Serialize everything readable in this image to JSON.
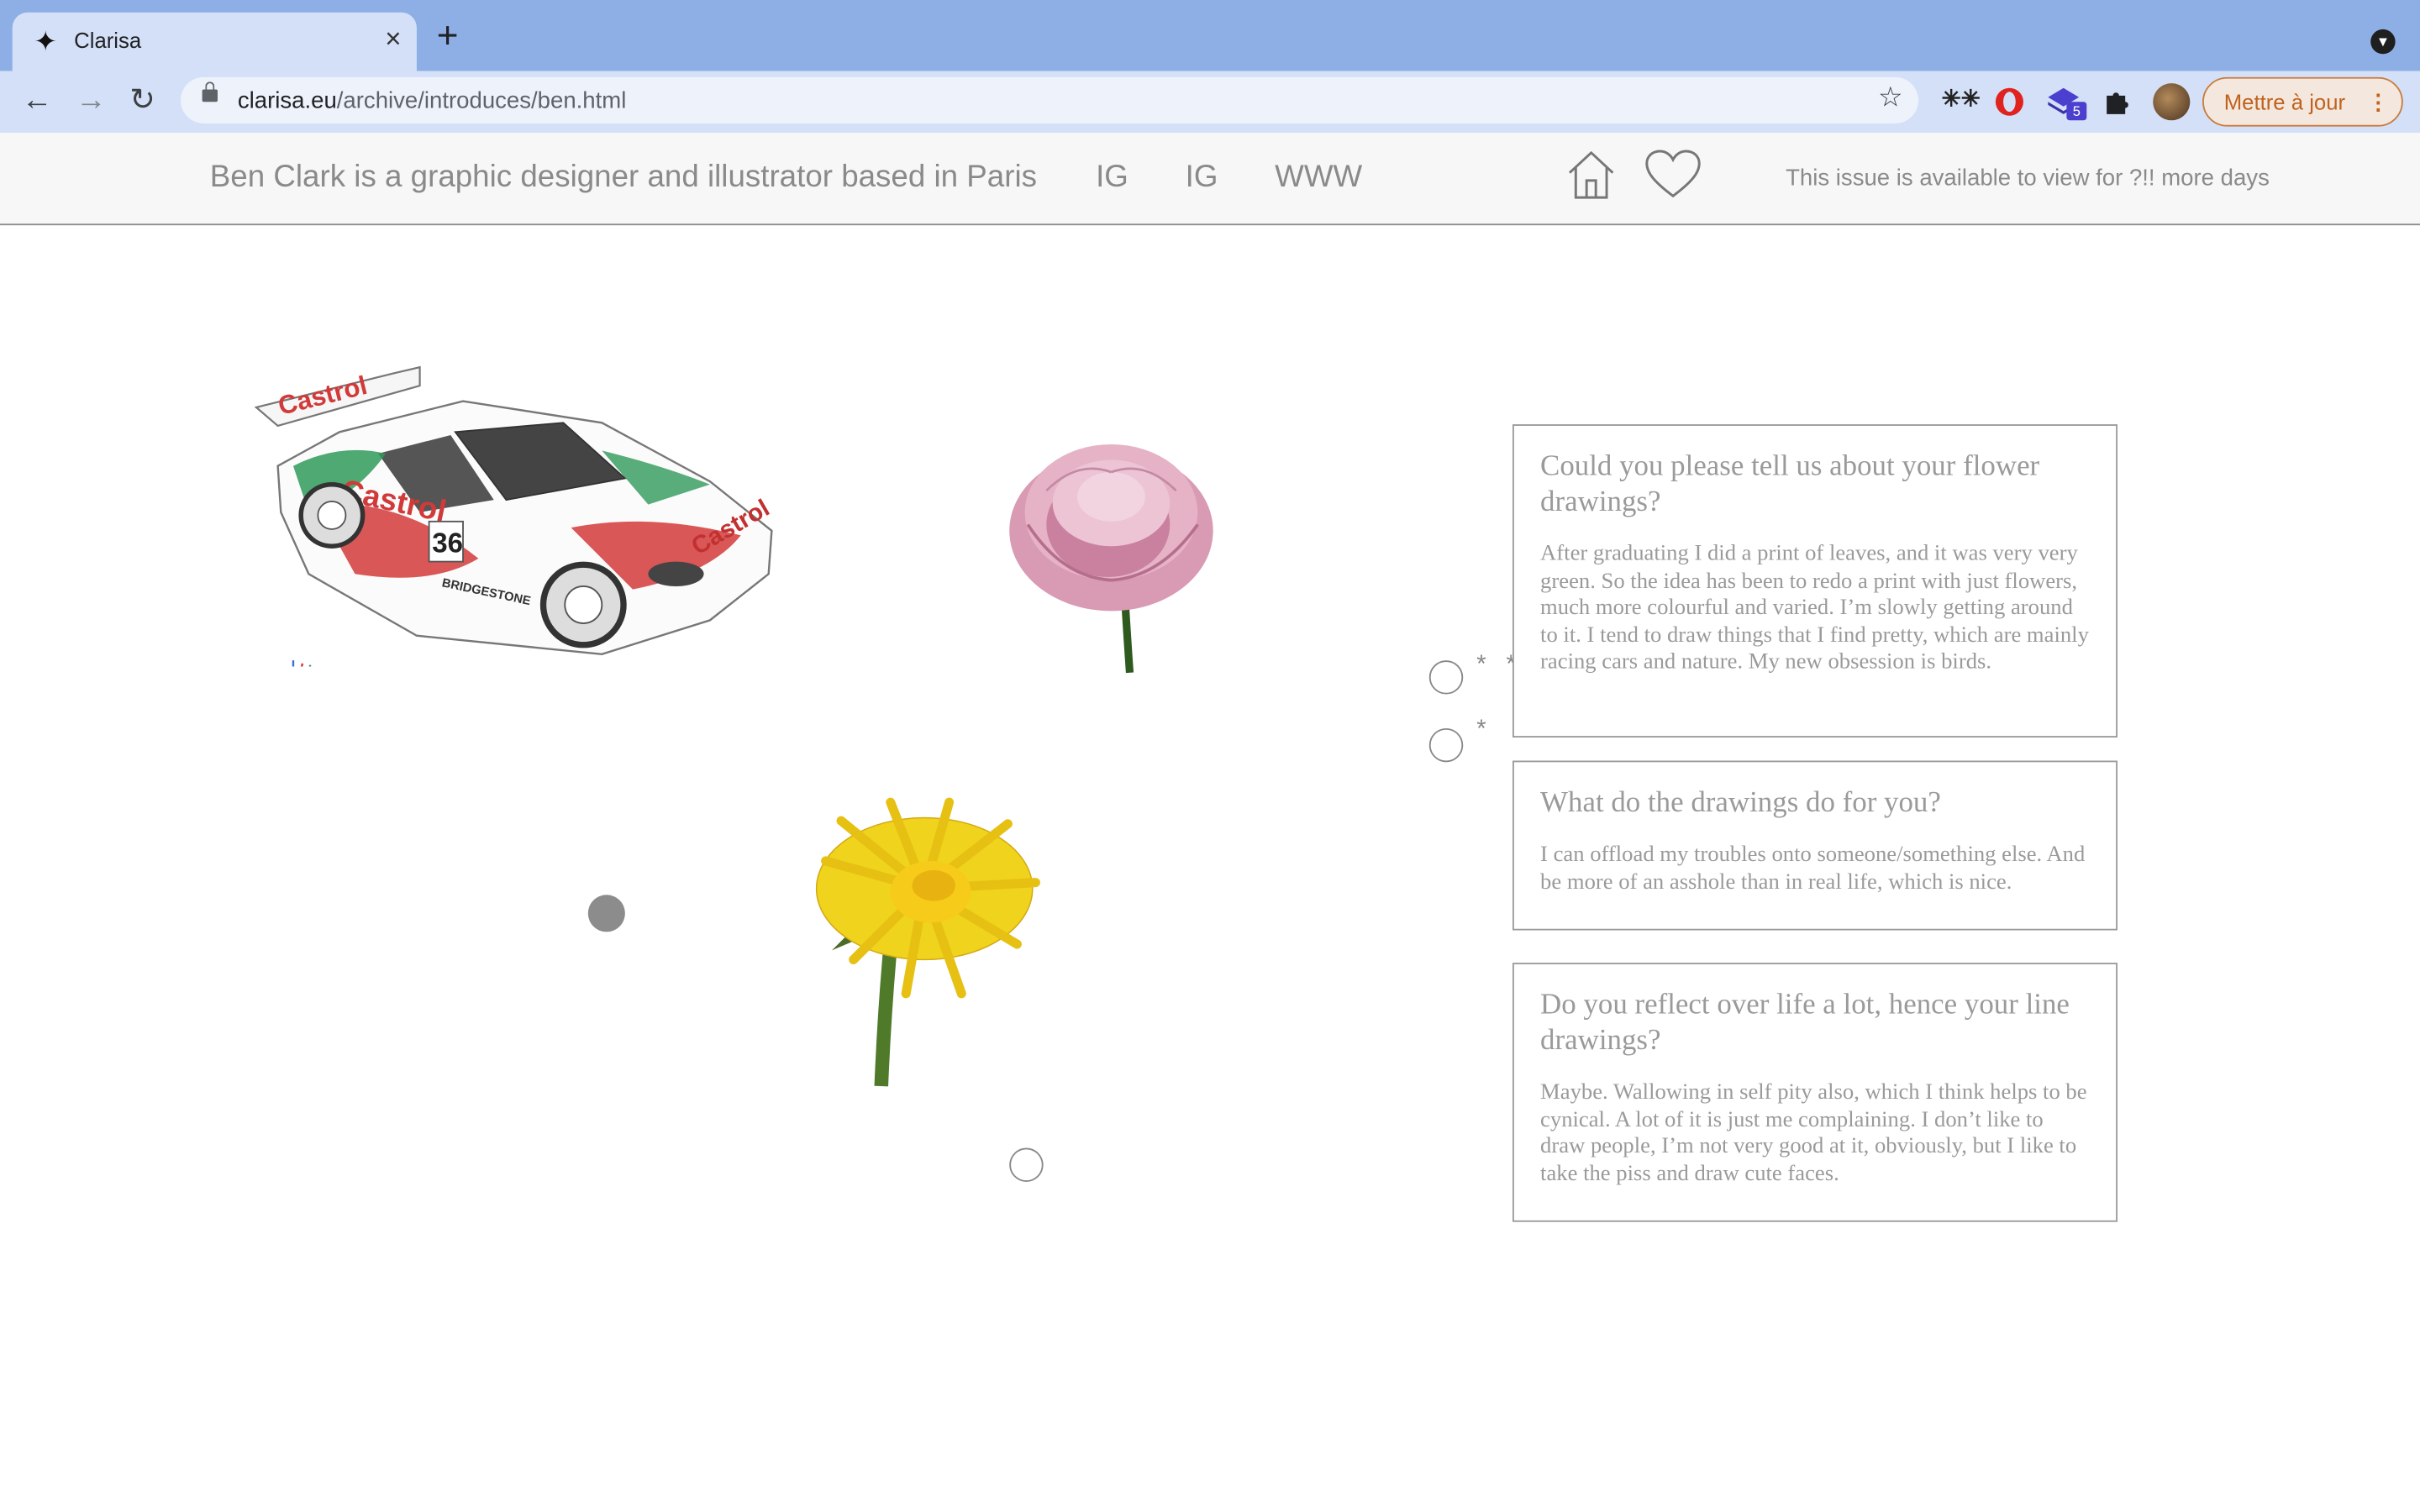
{
  "browser": {
    "tab_title": "Clarisa",
    "tab_favicon": "✦",
    "url_host": "clarisa.eu",
    "url_path": "/archive/introduces/ben.html",
    "update_button": "Mettre à jour",
    "extension_badge": "5"
  },
  "header": {
    "description": "Ben Clark is a graphic designer and illustrator based in Paris",
    "links": [
      "IG",
      "IG",
      "WWW"
    ],
    "availability": "This issue is available to view for ?!! more days"
  },
  "interview": [
    {
      "question": "Could you please tell us about your flower drawings?",
      "answer": "After graduating I did a print of leaves, and it was very very green. So the idea has been to redo a print with just flowers, much more colourful and varied. I’m slowly getting around to it. I tend to draw things that I find pretty, which are mainly racing cars and nature. My new obsession is birds."
    },
    {
      "question": "What do the drawings do for you?",
      "answer": "I can offload my troubles onto someone/something else. And be more of an asshole than in real life, which is nice."
    },
    {
      "question": "Do you reflect over life a lot, hence your line drawings?",
      "answer": "Maybe. Wallowing in self pity also, which I think helps to be cynical. A lot of it is just me complaining. I don’t like to draw people, I’m not very good at it, obviously, but I like to take the piss and draw cute faces."
    }
  ],
  "artwork": {
    "car_number": "36",
    "car_brand": "Castrol",
    "car_sponsor": "BRIDGESTONE"
  },
  "markers": {
    "asterisk_pair": "* *",
    "asterisk_single": "*"
  },
  "colors": {
    "tabstrip": "#8eaee6",
    "toolbar": "#d3e0f7",
    "text_gray": "#8a8a8a",
    "update_orange": "#c0621e"
  }
}
